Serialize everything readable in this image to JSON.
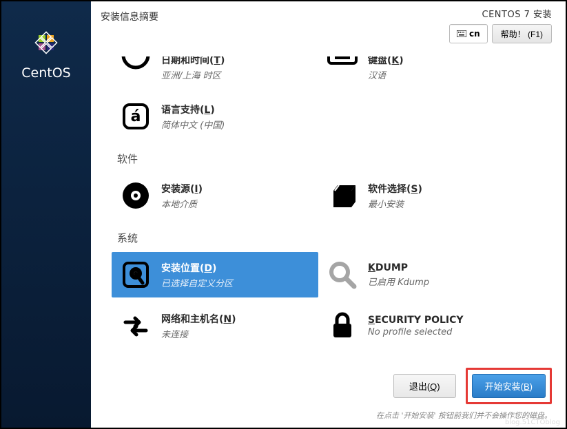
{
  "sidebar": {
    "brand": "CentOS"
  },
  "header": {
    "title": "安装信息摘要",
    "subtitle": "CENTOS 7 安装",
    "lang_code": "cn",
    "help_label": "帮助！ (F1)"
  },
  "localization": {
    "datetime": {
      "title_prefix": "日期和时间(",
      "key": "T",
      "title_suffix": ")",
      "status": "亚洲/上海 时区"
    },
    "keyboard": {
      "title_prefix": "键盘(",
      "key": "K",
      "title_suffix": ")",
      "status": "汉语"
    },
    "language": {
      "title_prefix": "语言支持(",
      "key": "L",
      "title_suffix": ")",
      "status": "简体中文 (中国)"
    }
  },
  "categories": {
    "software": "软件",
    "system": "系统"
  },
  "software": {
    "source": {
      "title_prefix": "安装源(",
      "key": "I",
      "title_suffix": ")",
      "status": "本地介质"
    },
    "selection": {
      "title_prefix": "软件选择(",
      "key": "S",
      "title_suffix": ")",
      "status": "最小安装"
    }
  },
  "system": {
    "destination": {
      "title_prefix": "安装位置(",
      "key": "D",
      "title_suffix": ")",
      "status": "已选择自定义分区"
    },
    "kdump": {
      "key": "K",
      "title_rest": "DUMP",
      "status": "已启用 Kdump"
    },
    "network": {
      "title_prefix": "网络和主机名(",
      "key": "N",
      "title_suffix": ")",
      "status": "未连接"
    },
    "security": {
      "key": "S",
      "title_rest": "ECURITY POLICY",
      "status": "No profile selected"
    }
  },
  "footer": {
    "quit_prefix": "退出(",
    "quit_key": "Q",
    "quit_suffix": ")",
    "begin_prefix": "开始安装(",
    "begin_key": "B",
    "begin_suffix": ")",
    "note": "在点击 '开始安装' 按钮前我们并不会操作您的磁盘。"
  },
  "watermark": "blog.51CTOblog"
}
